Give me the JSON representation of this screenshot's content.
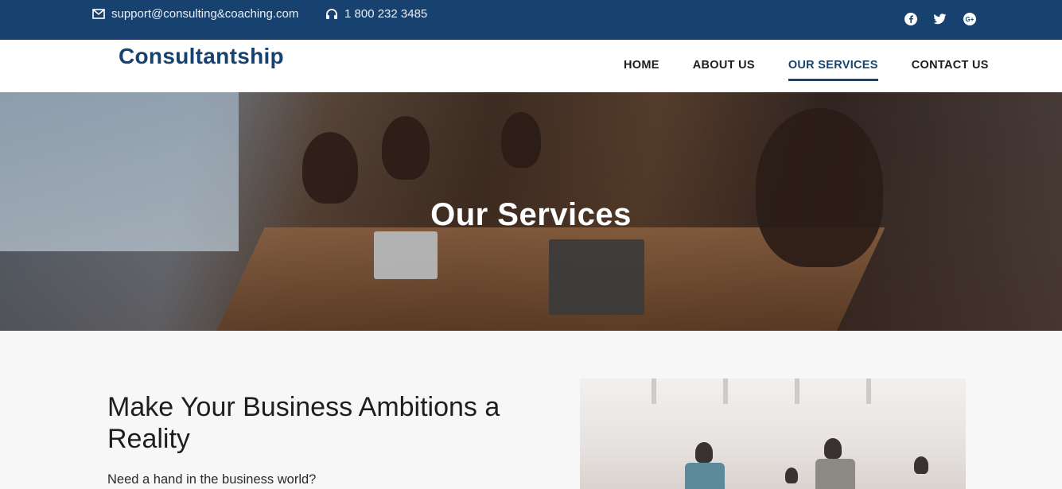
{
  "topbar": {
    "email": "support@consulting&coaching.com",
    "phone": "1 800 232 3485",
    "email_icon": "envelope-icon",
    "phone_icon": "headphones-icon",
    "social": [
      "facebook-icon",
      "twitter-icon",
      "google-plus-icon"
    ]
  },
  "header": {
    "logo": "Consultantship",
    "nav": [
      {
        "label": "HOME",
        "active": false
      },
      {
        "label": "ABOUT US",
        "active": false
      },
      {
        "label": "OUR SERVICES",
        "active": true
      },
      {
        "label": "CONTACT US",
        "active": false
      }
    ]
  },
  "hero": {
    "title": "Our Services"
  },
  "main": {
    "headline": "Make Your Business Ambitions a Reality",
    "lead": "Need a hand in the business world?"
  },
  "colors": {
    "brand": "#17426f",
    "background": "#f7f7f7",
    "white": "#ffffff"
  }
}
